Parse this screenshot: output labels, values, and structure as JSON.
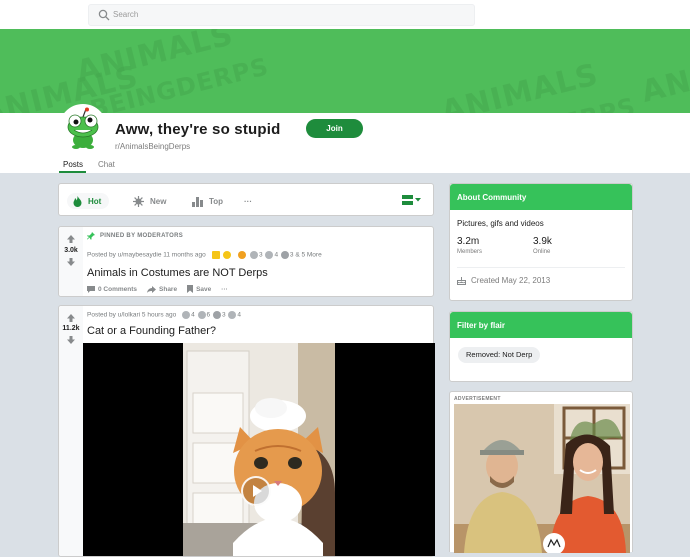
{
  "search": {
    "placeholder": "Search"
  },
  "banner": {
    "watermark_lines": [
      "ANIMALS",
      "BEINGDERPS"
    ]
  },
  "subreddit": {
    "title": "Aww, they're so stupid",
    "name": "r/AnimalsBeingDerps",
    "join_label": "Join",
    "tabs": [
      "Posts",
      "Chat"
    ],
    "active_tab": "Posts"
  },
  "sort": {
    "options": [
      "Hot",
      "New",
      "Top"
    ],
    "active": "Hot",
    "more": "···"
  },
  "posts": [
    {
      "pinned_label": "PINNED BY MODERATORS",
      "score": "3.0k",
      "meta": "Posted by u/maybesaydie 11 months ago",
      "award_counts": [
        "3",
        "4",
        "3"
      ],
      "award_more": "& 5 More",
      "title": "Animals in Costumes are NOT Derps",
      "comments": "0 Comments",
      "share": "Share",
      "save": "Save",
      "more": "···"
    },
    {
      "score": "11.2k",
      "meta": "Posted by u/lolkari 5 hours ago",
      "award_counts": [
        "4",
        "6",
        "3",
        "4"
      ],
      "title": "Cat or a Founding Father?"
    }
  ],
  "about": {
    "header": "About Community",
    "description": "Pictures, gifs and videos",
    "members_value": "3.2m",
    "members_label": "Members",
    "online_value": "3.9k",
    "online_label": "Online",
    "created": "Created May 22, 2013"
  },
  "flair": {
    "header": "Filter by flair",
    "chip": "Removed: Not Derp"
  },
  "ad": {
    "label": "ADVERTISEMENT"
  },
  "colors": {
    "accent": "#36c25a",
    "join": "#1e8c3c",
    "banner": "#4fbd5a"
  }
}
